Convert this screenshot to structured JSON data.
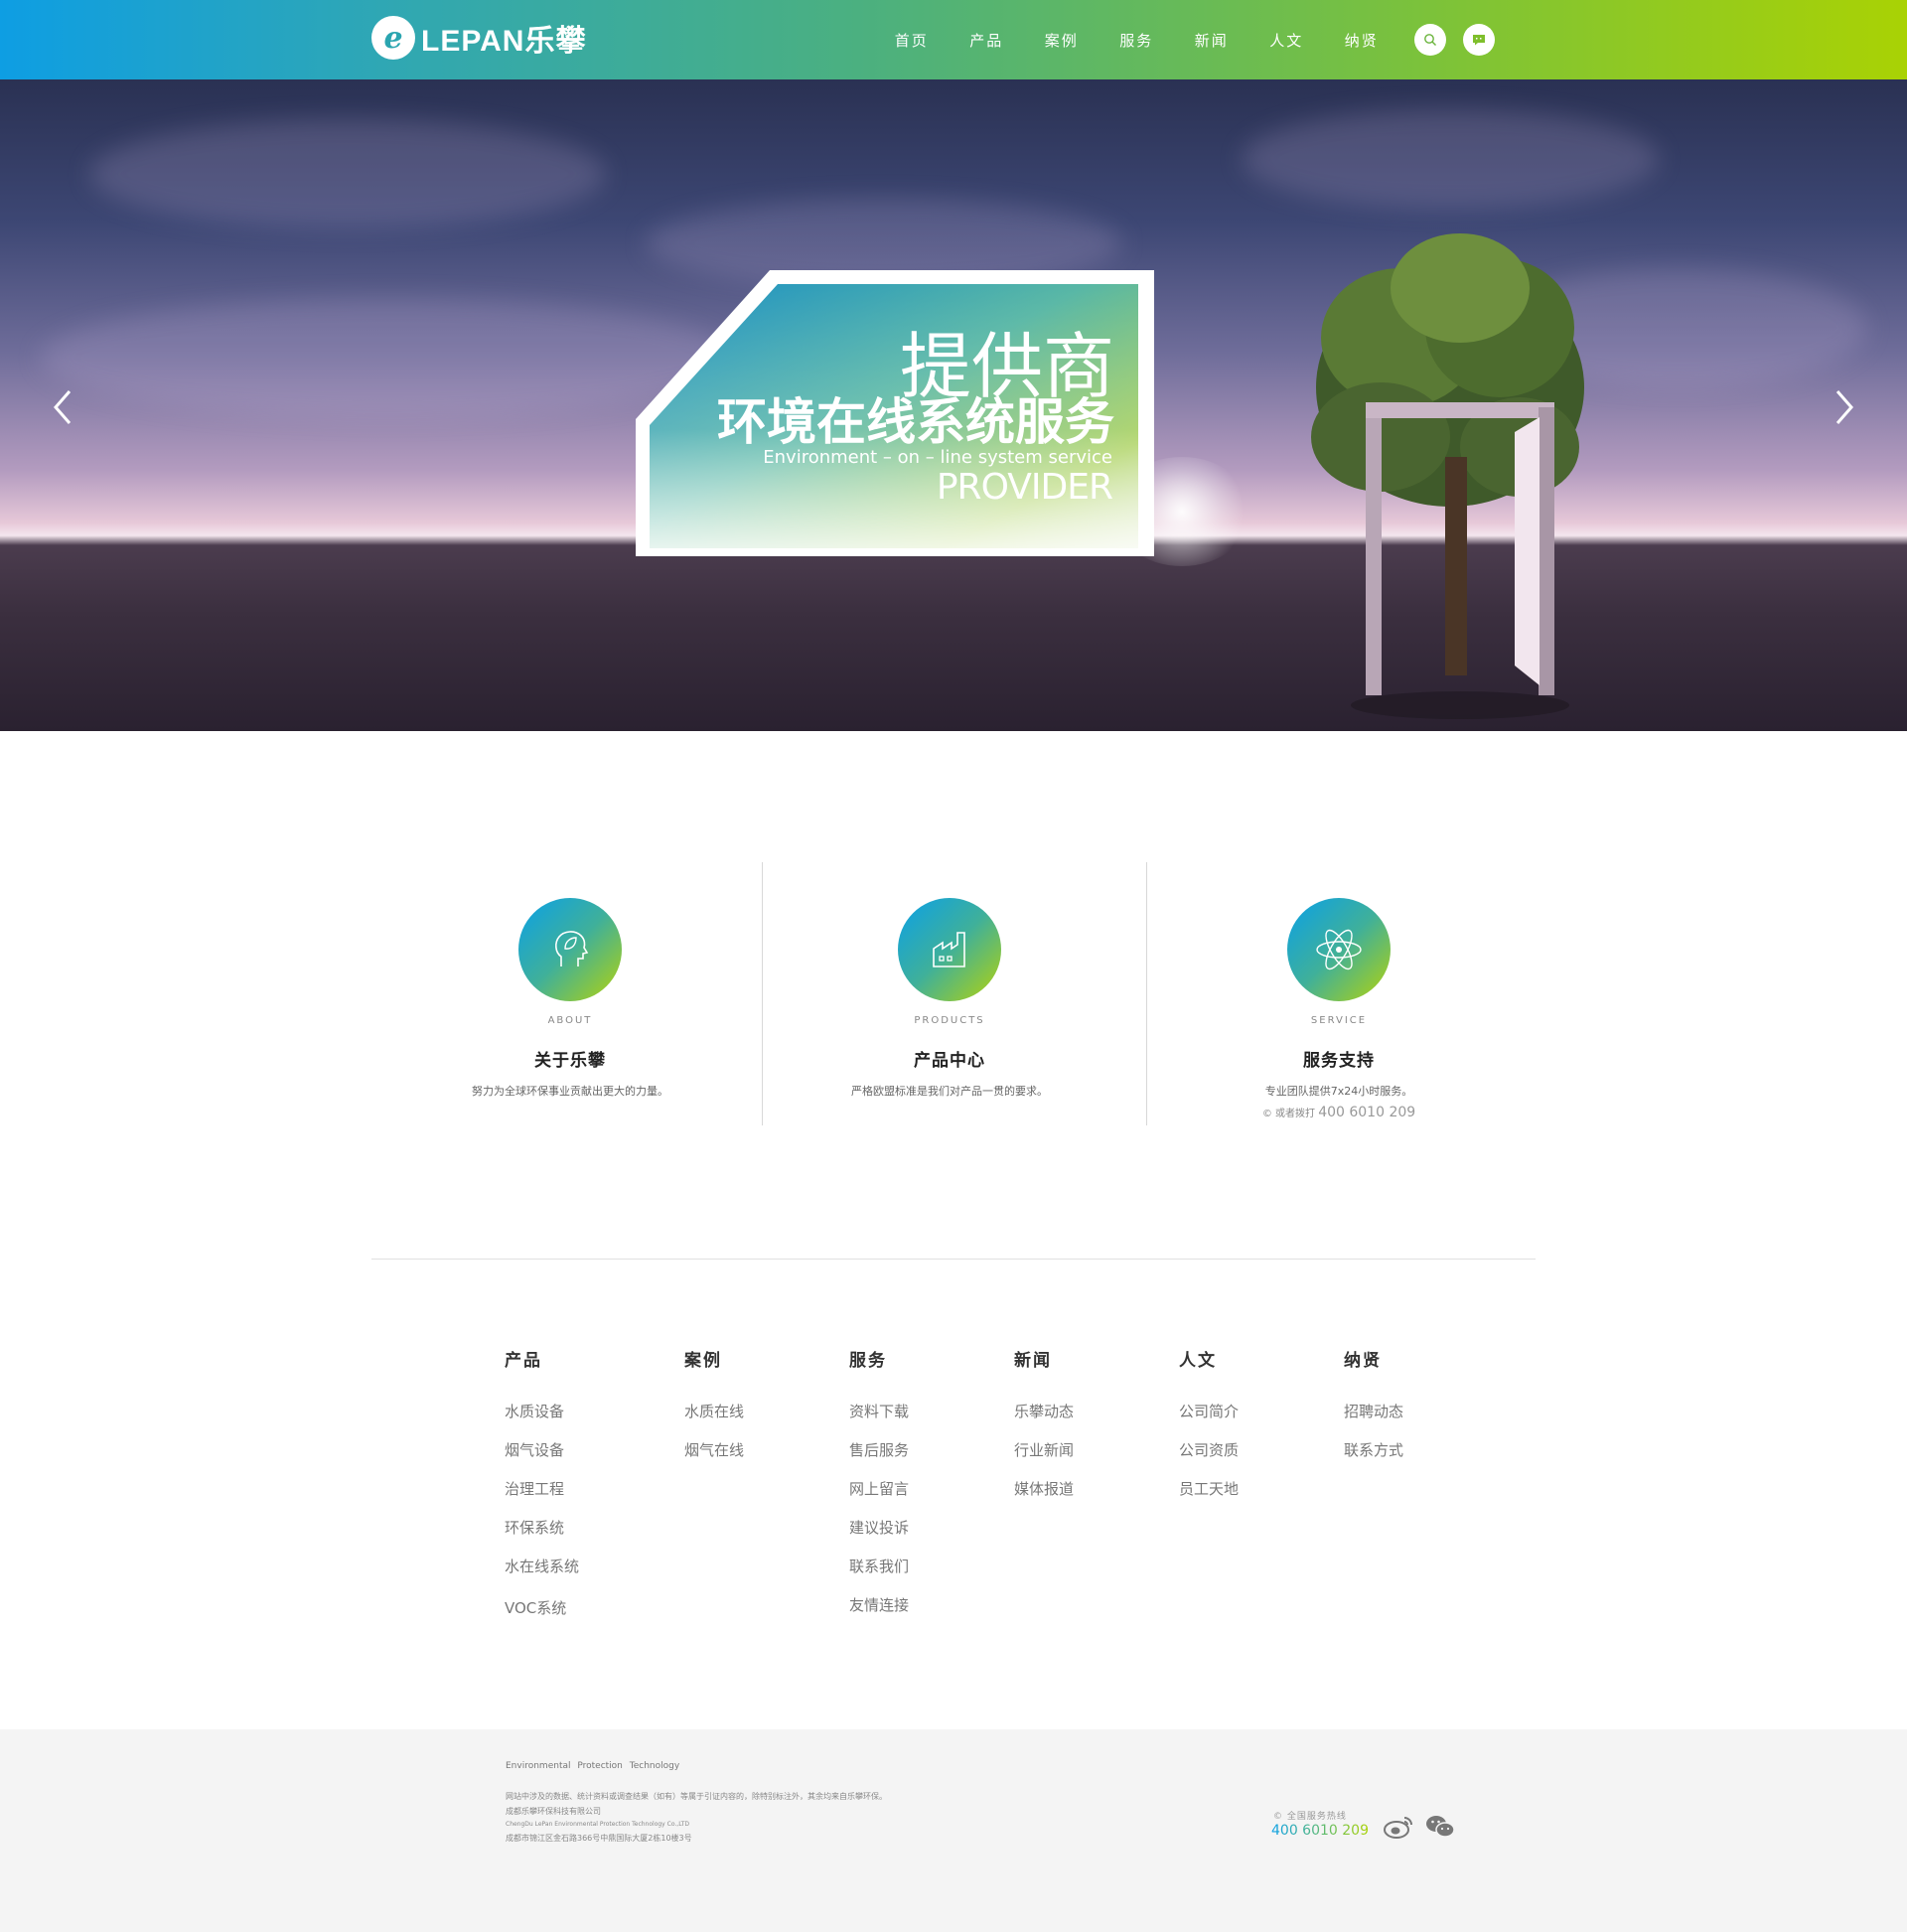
{
  "header": {
    "logo_text": "LEPAN乐攀",
    "logo_mark": "e",
    "nav": [
      "首页",
      "产品",
      "案例",
      "服务",
      "新闻",
      "人文",
      "纳贤"
    ],
    "search_icon": "search-icon",
    "chat_icon": "chat-icon"
  },
  "banner": {
    "title1": "提供商",
    "title2": "环境在线系统服务",
    "subtitle_en": "Environment – on – line system service",
    "provider": "PROVIDER",
    "prev_icon": "chevron-left-icon",
    "next_icon": "chevron-right-icon"
  },
  "features": [
    {
      "en": "ABOUT",
      "cn": "关于乐攀",
      "desc": "努力为全球环保事业贡献出更大的力量。",
      "icon": "head-leaf-icon"
    },
    {
      "en": "PRODUCTS",
      "cn": "产品中心",
      "desc": "严格欧盟标准是我们对产品一贯的要求。",
      "icon": "factory-icon"
    },
    {
      "en": "SERVICE",
      "cn": "服务支持",
      "desc": "专业团队提供7x24小时服务。",
      "hotline_label": "© 或者拨打",
      "hotline": "400 6010 209",
      "icon": "atom-icon"
    }
  ],
  "sitemap": [
    {
      "title": "产品",
      "links": [
        "水质设备",
        "烟气设备",
        "治理工程",
        "环保系统",
        "水在线系统",
        "VOC系统"
      ]
    },
    {
      "title": "案例",
      "links": [
        "水质在线",
        "烟气在线"
      ]
    },
    {
      "title": "服务",
      "links": [
        "资料下载",
        "售后服务",
        "网上留言",
        "建议投诉",
        "联系我们",
        "友情连接"
      ]
    },
    {
      "title": "新闻",
      "links": [
        "乐攀动态",
        "行业新闻",
        "媒体报道"
      ]
    },
    {
      "title": "人文",
      "links": [
        "公司简介",
        "公司资质",
        "员工天地"
      ]
    },
    {
      "title": "纳贤",
      "links": [
        "招聘动态",
        "联系方式"
      ]
    }
  ],
  "footer": {
    "en": "Environmental Protection Technology",
    "disclaimer": "网站中涉及的数据、统计资料或调查结果（如有）等属于引证内容的，除特别标注外，其余均来自乐攀环保。",
    "company": "成都乐攀环保科技有限公司",
    "company_en": "ChengDu LePan Environmental Protection Technology Co.,LTD",
    "address": "成都市锦江区金石路366号中鼎国际大厦2栋10楼3号",
    "hotline_label": "© 全国服务热线",
    "hotline": "400 6010 209",
    "weibo_icon": "weibo-icon",
    "wechat_icon": "wechat-icon"
  },
  "colors": {
    "gradient_start": "#0e9ee3",
    "gradient_end": "#a9d204"
  }
}
